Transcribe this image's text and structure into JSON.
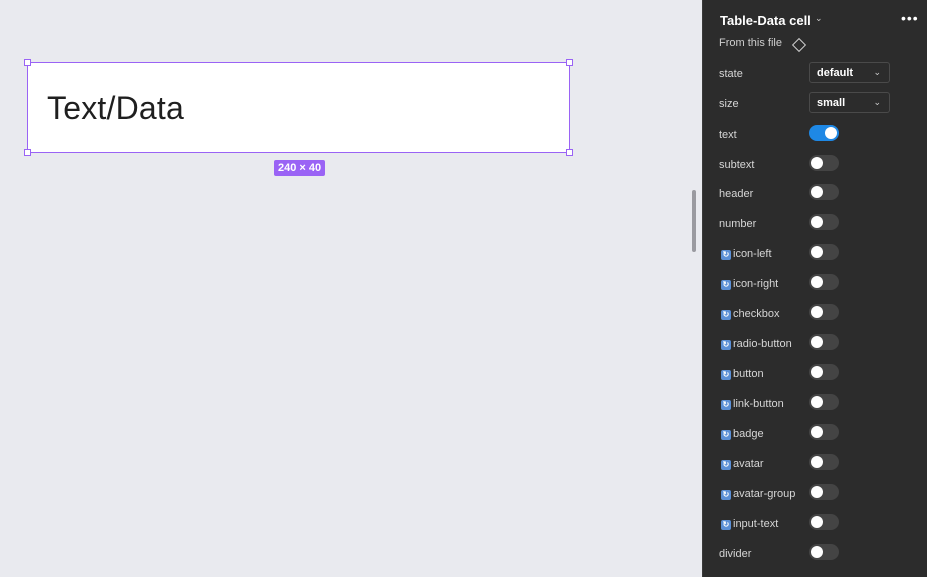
{
  "canvas": {
    "frame_text": "Text/Data",
    "size_badge": "240 × 40"
  },
  "panel": {
    "title": "Table-Data cell",
    "from_file": "From this file",
    "properties": [
      {
        "label": "state",
        "type": "select",
        "value": "default",
        "component": false
      },
      {
        "label": "size",
        "type": "select",
        "value": "small",
        "component": false
      },
      {
        "label": "text",
        "type": "toggle",
        "on": true,
        "component": false
      },
      {
        "label": "subtext",
        "type": "toggle",
        "on": false,
        "component": false
      },
      {
        "label": "header",
        "type": "toggle",
        "on": false,
        "component": false
      },
      {
        "label": "number",
        "type": "toggle",
        "on": false,
        "component": false
      },
      {
        "label": "icon-left",
        "type": "toggle",
        "on": false,
        "component": true
      },
      {
        "label": "icon-right",
        "type": "toggle",
        "on": false,
        "component": true
      },
      {
        "label": "checkbox",
        "type": "toggle",
        "on": false,
        "component": true
      },
      {
        "label": "radio-button",
        "type": "toggle",
        "on": false,
        "component": true
      },
      {
        "label": "button",
        "type": "toggle",
        "on": false,
        "component": true
      },
      {
        "label": "link-button",
        "type": "toggle",
        "on": false,
        "component": true
      },
      {
        "label": "badge",
        "type": "toggle",
        "on": false,
        "component": true
      },
      {
        "label": "avatar",
        "type": "toggle",
        "on": false,
        "component": true
      },
      {
        "label": "avatar-group",
        "type": "toggle",
        "on": false,
        "component": true
      },
      {
        "label": "input-text",
        "type": "toggle",
        "on": false,
        "component": true
      },
      {
        "label": "divider",
        "type": "toggle",
        "on": false,
        "component": false
      }
    ]
  },
  "colors": {
    "selection": "#9a63f5",
    "toggle_on": "#1e88e5",
    "panel_bg": "#2c2c2c",
    "canvas_bg": "#e9eaef"
  }
}
